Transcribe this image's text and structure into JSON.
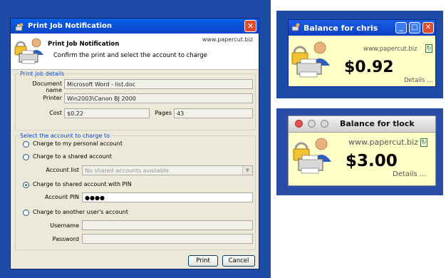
{
  "dialog": {
    "title": "Print Job Notification",
    "header_title": "Print Job Notification",
    "header_subtitle": "Confirm the print and select the account to charge",
    "url": "www.papercut.biz",
    "close_glyph": "✕"
  },
  "details": {
    "legend": "Print job details",
    "document_label": "Document name",
    "document_value": "Microsoft Word - list.doc",
    "printer_label": "Printer",
    "printer_value": "Win2003\\Canon BJ 2000",
    "cost_label": "Cost",
    "cost_value": "$0.22",
    "pages_label": "Pages",
    "pages_value": "43"
  },
  "account": {
    "legend": "Select the account to charge to",
    "opt_personal": "Charge to my personal account",
    "opt_shared": "Charge to a shared account",
    "account_list_label": "Account list",
    "account_list_value": "No shared accounts available",
    "opt_shared_pin": "Charge to shared account with PIN",
    "account_pin_label": "Account PIN",
    "account_pin_value": "●●●●",
    "opt_other_user": "Charge to another user's account",
    "username_label": "Username",
    "password_label": "Password"
  },
  "buttons": {
    "print": "Print",
    "cancel": "Cancel"
  },
  "balance_windows": [
    {
      "title": "Balance for chris",
      "url": "www.papercut.biz",
      "amount": "$0.92",
      "details": "Details ..."
    },
    {
      "title": "Balance for tlock",
      "url": "www.papercut.biz",
      "amount": "$3.00",
      "details": "Details ..."
    }
  ],
  "colors": {
    "panel_blue": "#1e4aa8",
    "xp_title": "#0b44c9",
    "balance_bg": "#ffffc8"
  }
}
